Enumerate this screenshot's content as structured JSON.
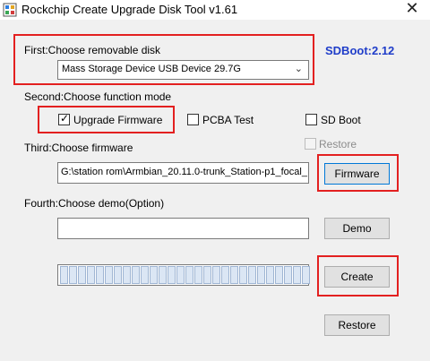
{
  "window": {
    "title": "Rockchip Create Upgrade Disk Tool v1.61",
    "close_glyph": "✕",
    "app_icon": "rockchip-app-icon"
  },
  "first": {
    "label": "First:Choose removable disk",
    "disk_selected": "Mass Storage Device USB Device   29.7G",
    "dropdown_glyph": "⌄"
  },
  "sdboot_version": "SDBoot:2.12",
  "second": {
    "label": "Second:Choose function mode",
    "options": [
      {
        "label": "Upgrade Firmware",
        "checked": true,
        "enabled": true
      },
      {
        "label": "PCBA Test",
        "checked": false,
        "enabled": true
      },
      {
        "label": "SD Boot",
        "checked": false,
        "enabled": true
      }
    ],
    "restore_option": {
      "label": "Restore",
      "checked": false,
      "enabled": false
    }
  },
  "third": {
    "label": "Third:Choose firmware",
    "firmware_path": "G:\\station rom\\Armbian_20.11.0-trunk_Station-p1_focal_",
    "firmware_button": "Firmware"
  },
  "fourth": {
    "label": "Fourth:Choose demo(Option)",
    "demo_path": "",
    "demo_button": "Demo"
  },
  "progress": {
    "segments": 28,
    "completed_fraction": 0
  },
  "actions": {
    "create_button": "Create",
    "restore_button": "Restore"
  },
  "colors": {
    "highlight": "#e32020",
    "sdboot_text": "#1f3dc9",
    "focus_border": "#0078d7"
  }
}
